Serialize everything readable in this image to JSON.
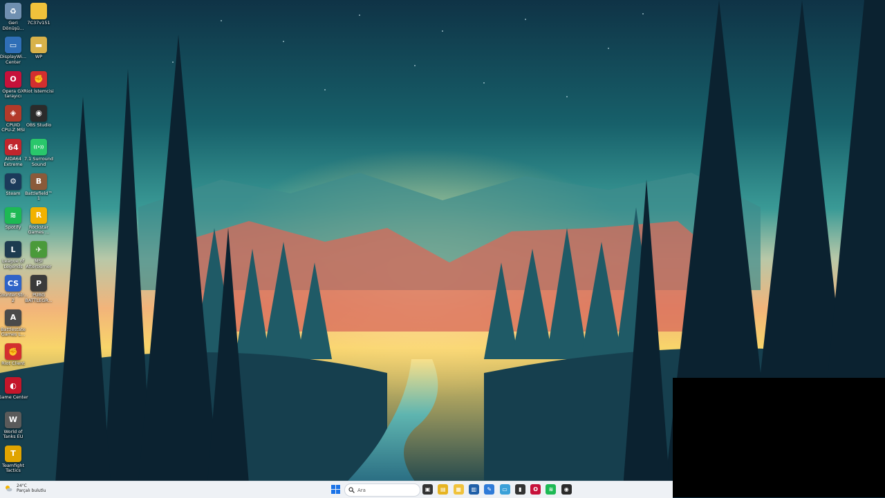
{
  "desktop": {
    "icons": [
      {
        "label": "Geri\nDönüşü...",
        "glyph": "♻",
        "color": "#6f8fb0",
        "icon": "recycle-bin-icon"
      },
      {
        "label": "7C37v151",
        "glyph": "",
        "color": "#f0c23b",
        "icon": "folder-icon"
      },
      {
        "label": "DisplayWi...\nCenter",
        "glyph": "▭",
        "color": "#2f6fb7",
        "icon": "display-center-icon"
      },
      {
        "label": "WP",
        "glyph": "▬",
        "color": "#d8b24a",
        "icon": "wp-icon"
      },
      {
        "label": "Opera GX\ntarayıcı",
        "glyph": "O",
        "color": "#c7113a",
        "icon": "opera-gx-icon"
      },
      {
        "label": "Riot İstemcisi",
        "glyph": "✊",
        "color": "#d32f2f",
        "icon": "riot-client-icon"
      },
      {
        "label": "CPUID\nCPU-Z MSI",
        "glyph": "◈",
        "color": "#b23a2a",
        "icon": "cpu-z-icon"
      },
      {
        "label": "OBS Studio",
        "glyph": "◉",
        "color": "#2b2b2b",
        "icon": "obs-studio-icon"
      },
      {
        "label": "AIDA64\nExtreme",
        "glyph": "64",
        "color": "#c0262d",
        "icon": "aida64-icon"
      },
      {
        "label": "7.1 Surround\nSound",
        "glyph": "((•))",
        "color": "#29c76b",
        "icon": "surround-sound-icon"
      },
      {
        "label": "Steam",
        "glyph": "⚙",
        "color": "#1b3a5a",
        "icon": "steam-icon"
      },
      {
        "label": "Battlefield™ 1",
        "glyph": "B",
        "color": "#8a5a3a",
        "icon": "battlefield-icon"
      },
      {
        "label": "Spotify",
        "glyph": "≋",
        "color": "#1db954",
        "icon": "spotify-icon"
      },
      {
        "label": "Rockstar\nGames ...",
        "glyph": "R",
        "color": "#f2b200",
        "icon": "rockstar-icon"
      },
      {
        "label": "League of\nLegends",
        "glyph": "L",
        "color": "#1d3b4f",
        "icon": "league-of-legends-icon"
      },
      {
        "label": "MSI\nAfterburner",
        "glyph": "✈",
        "color": "#4a9a3a",
        "icon": "msi-afterburner-icon"
      },
      {
        "label": "Counter-Str...\n2",
        "glyph": "CS",
        "color": "#2f63c7",
        "icon": "counter-strike-icon"
      },
      {
        "label": "PUBG\nBATTLEGR...",
        "glyph": "P",
        "color": "#3a3a3a",
        "icon": "pubg-icon"
      },
      {
        "label": "Battlestate\nGames L...",
        "glyph": "A",
        "color": "#4a4a4a",
        "icon": "battlestate-launcher-icon"
      },
      {
        "label": "Riot Client",
        "glyph": "✊",
        "color": "#d32f2f",
        "icon": "riot-client-2-icon"
      },
      {
        "label": "Game Center",
        "glyph": "◐",
        "color": "#c4162a",
        "icon": "game-center-icon"
      },
      {
        "label": "World of\nTanks EU",
        "glyph": "W",
        "color": "#5a5a5a",
        "icon": "world-of-tanks-icon"
      },
      {
        "label": "Teamfight\nTactics",
        "glyph": "T",
        "color": "#e0a400",
        "icon": "teamfight-tactics-icon"
      }
    ]
  },
  "taskbar": {
    "weather_temp": "24°C",
    "weather_desc": "Parçalı bulutlu",
    "search_placeholder": "Ara",
    "pinned": [
      {
        "icon": "task-view-icon",
        "glyph": "▣",
        "color": "#333"
      },
      {
        "icon": "file-explorer-icon",
        "glyph": "▤",
        "color": "#e6b422"
      },
      {
        "icon": "files-icon",
        "glyph": "▦",
        "color": "#f0c23b"
      },
      {
        "icon": "app-icon",
        "glyph": "▥",
        "color": "#1f5fa8"
      },
      {
        "icon": "photos-icon",
        "glyph": "✎",
        "color": "#2f7bd8"
      },
      {
        "icon": "remote-desktop-icon",
        "glyph": "▭",
        "color": "#3aa0d8"
      },
      {
        "icon": "terminal-icon",
        "glyph": "▮",
        "color": "#333"
      },
      {
        "icon": "opera-gx-taskbar-icon",
        "glyph": "O",
        "color": "#c7113a"
      },
      {
        "icon": "spotify-taskbar-icon",
        "glyph": "≋",
        "color": "#1db954"
      },
      {
        "icon": "obs-taskbar-icon",
        "glyph": "◉",
        "color": "#2b2b2b"
      }
    ]
  }
}
